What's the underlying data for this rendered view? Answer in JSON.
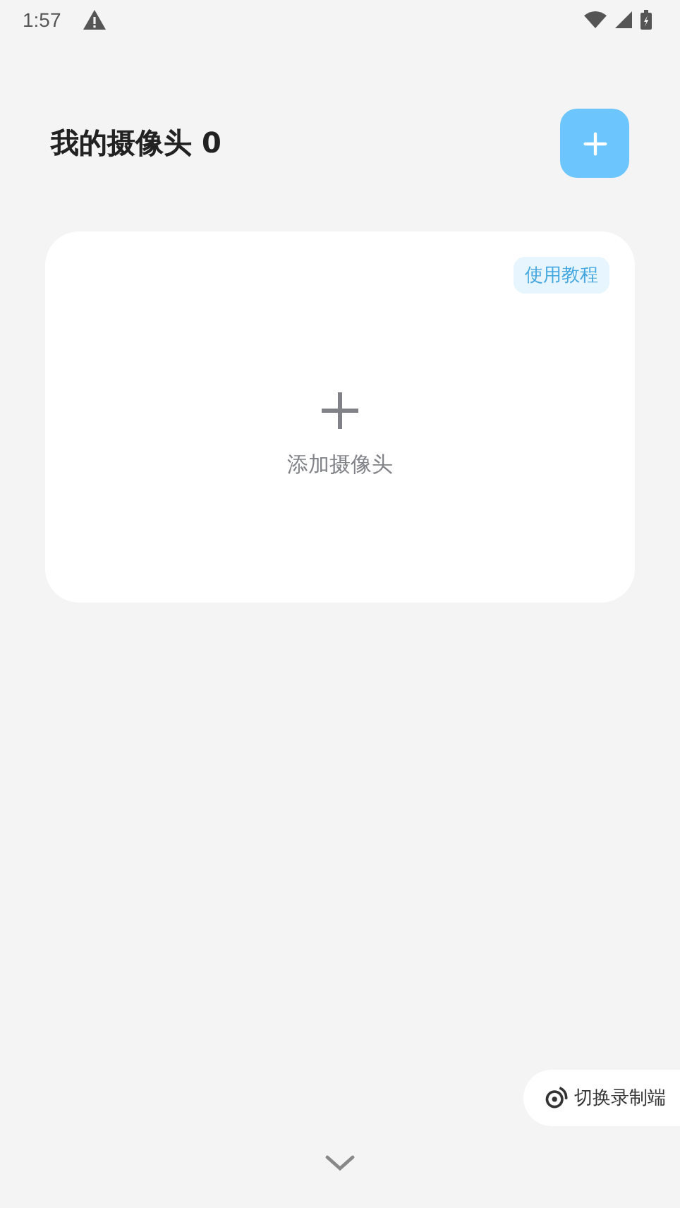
{
  "status_bar": {
    "time": "1:57"
  },
  "header": {
    "title": "我的摄像头 0"
  },
  "card": {
    "tutorial": "使用教程",
    "add_label": "添加摄像头"
  },
  "switch_button": {
    "label": "切换录制端"
  }
}
